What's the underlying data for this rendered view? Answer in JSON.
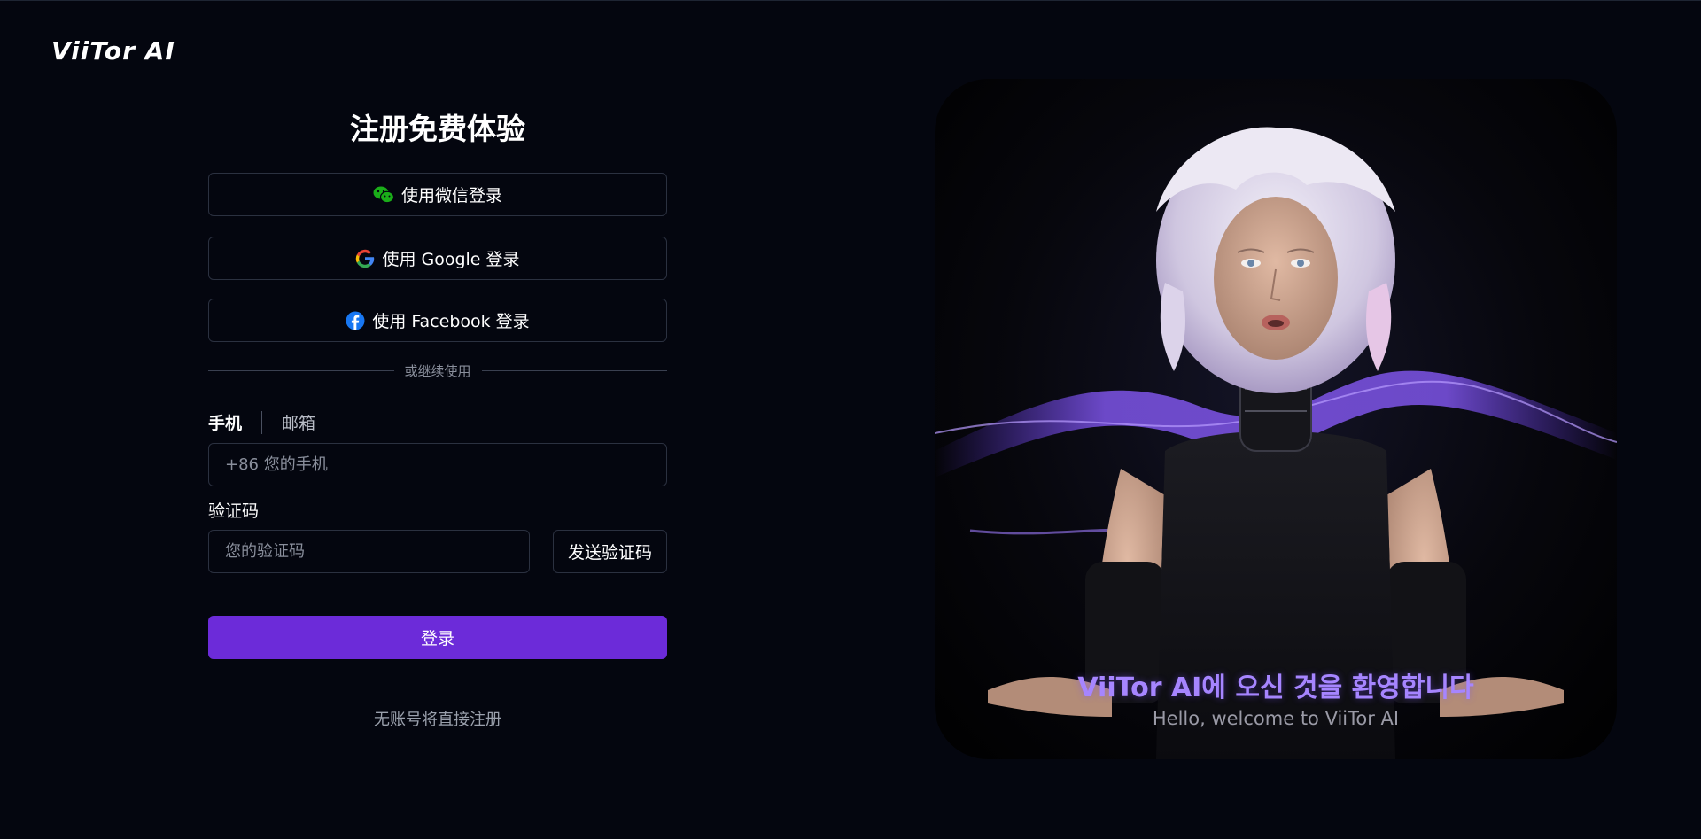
{
  "brand": {
    "logo_text": "ViiTor AI"
  },
  "form": {
    "title": "注册免费体验",
    "social": {
      "wechat_label": "使用微信登录",
      "google_label": "使用 Google 登录",
      "facebook_label": "使用 Facebook 登录"
    },
    "divider_text": "或继续使用",
    "tabs": {
      "phone": "手机",
      "email": "邮箱",
      "active": "手机"
    },
    "phone_input": {
      "placeholder": "+86 您的手机",
      "value": ""
    },
    "code_label": "验证码",
    "code_input": {
      "placeholder": "您的验证码",
      "value": ""
    },
    "send_code_label": "发送验证码",
    "login_label": "登录",
    "register_hint": "无账号将直接注册"
  },
  "hero": {
    "caption_ko": "ViiTor AI에 오신 것을 환영합니다",
    "caption_en": "Hello, welcome to ViiTor AI"
  },
  "colors": {
    "background": "#04060f",
    "primary": "#6c2bd9",
    "border": "#2b3140",
    "wechat_green": "#1aad19",
    "facebook_blue": "#1877f2",
    "caption_purple": "#a685ff"
  },
  "icons": {
    "wechat": "wechat-icon",
    "google": "google-icon",
    "facebook": "facebook-icon"
  }
}
